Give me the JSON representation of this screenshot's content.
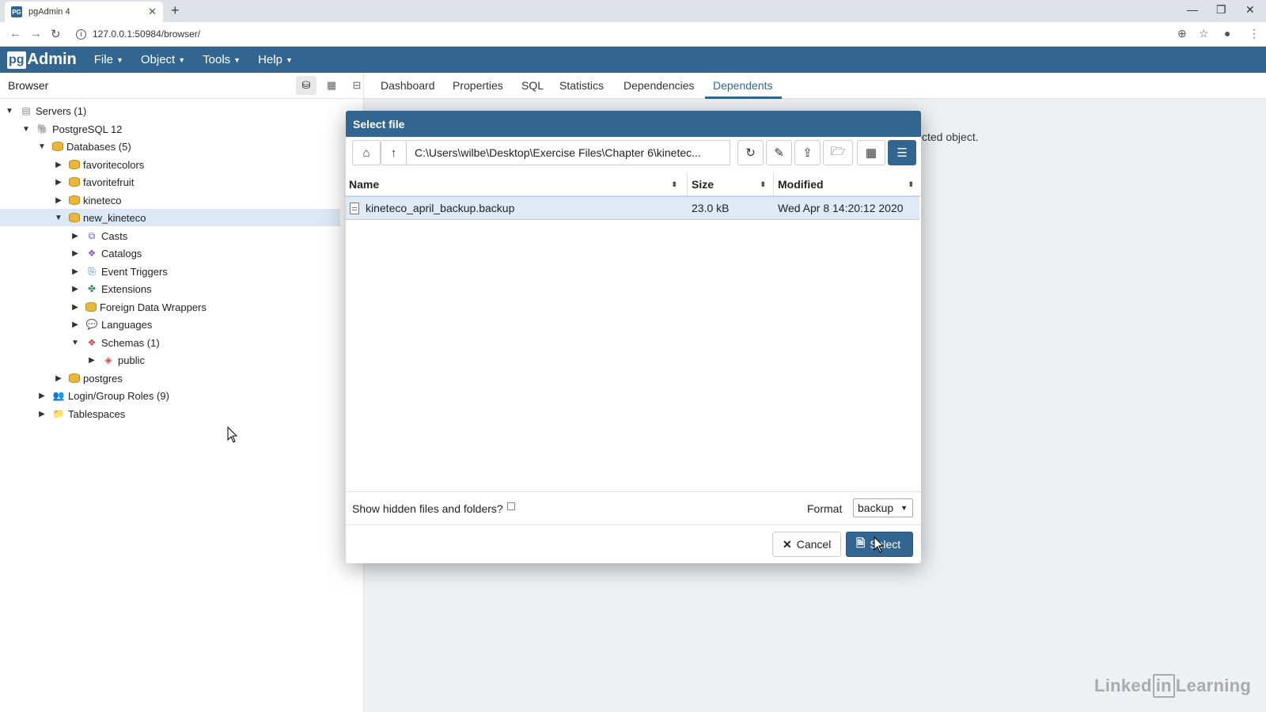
{
  "browser": {
    "tab_title": "pgAdmin 4",
    "url": "127.0.0.1:50984/browser/"
  },
  "pgadmin": {
    "logo_pg": "pg",
    "logo_admin": "Admin",
    "menus": [
      "File",
      "Object",
      "Tools",
      "Help"
    ]
  },
  "browser_panel": {
    "title": "Browser",
    "tree": [
      {
        "label": "Servers (1)",
        "expanded": true,
        "icon": "servers-icon"
      },
      {
        "label": "PostgreSQL 12",
        "expanded": true,
        "icon": "postgresql-server-icon"
      },
      {
        "label": "Databases (5)",
        "expanded": true,
        "icon": "databases-icon"
      },
      {
        "label": "favoritecolors",
        "expanded": false,
        "icon": "database-icon"
      },
      {
        "label": "favoritefruit",
        "expanded": false,
        "icon": "database-icon"
      },
      {
        "label": "kineteco",
        "expanded": false,
        "icon": "database-icon"
      },
      {
        "label": "new_kineteco",
        "expanded": true,
        "icon": "database-icon",
        "selected": true
      },
      {
        "label": "Casts",
        "expanded": false,
        "icon": "casts-icon"
      },
      {
        "label": "Catalogs",
        "expanded": false,
        "icon": "catalogs-icon"
      },
      {
        "label": "Event Triggers",
        "expanded": false,
        "icon": "event-triggers-icon"
      },
      {
        "label": "Extensions",
        "expanded": false,
        "icon": "extensions-icon"
      },
      {
        "label": "Foreign Data Wrappers",
        "expanded": false,
        "icon": "foreign-data-wrappers-icon"
      },
      {
        "label": "Languages",
        "expanded": false,
        "icon": "languages-icon"
      },
      {
        "label": "Schemas (1)",
        "expanded": true,
        "icon": "schemas-icon"
      },
      {
        "label": "public",
        "expanded": false,
        "icon": "schema-icon"
      },
      {
        "label": "postgres",
        "expanded": false,
        "icon": "database-icon"
      },
      {
        "label": "Login/Group Roles (9)",
        "expanded": false,
        "icon": "roles-icon"
      },
      {
        "label": "Tablespaces",
        "expanded": false,
        "icon": "tablespaces-icon"
      }
    ]
  },
  "main_tabs": [
    "Dashboard",
    "Properties",
    "SQL",
    "Statistics",
    "Dependencies",
    "Dependents"
  ],
  "active_tab": "Dependents",
  "content_message": "cted object.",
  "dialog": {
    "title": "Select file",
    "path": "C:\\Users\\wilbe\\Desktop\\Exercise Files\\Chapter 6\\kinetec...",
    "columns": [
      "Name",
      "Size",
      "Modified"
    ],
    "files": [
      {
        "name": "kineteco_april_backup.backup",
        "size": "23.0 kB",
        "modified": "Wed Apr 8 14:20:12 2020"
      }
    ],
    "show_hidden_label": "Show hidden files and folders?",
    "format_label": "Format",
    "format_value": "backup",
    "cancel_label": "Cancel",
    "select_label": "Select"
  },
  "watermark": {
    "left": "Linked",
    "mid": "in",
    "right": "Learning"
  },
  "colors": {
    "brand": "#326690",
    "selected_row": "#dfeaf6"
  }
}
